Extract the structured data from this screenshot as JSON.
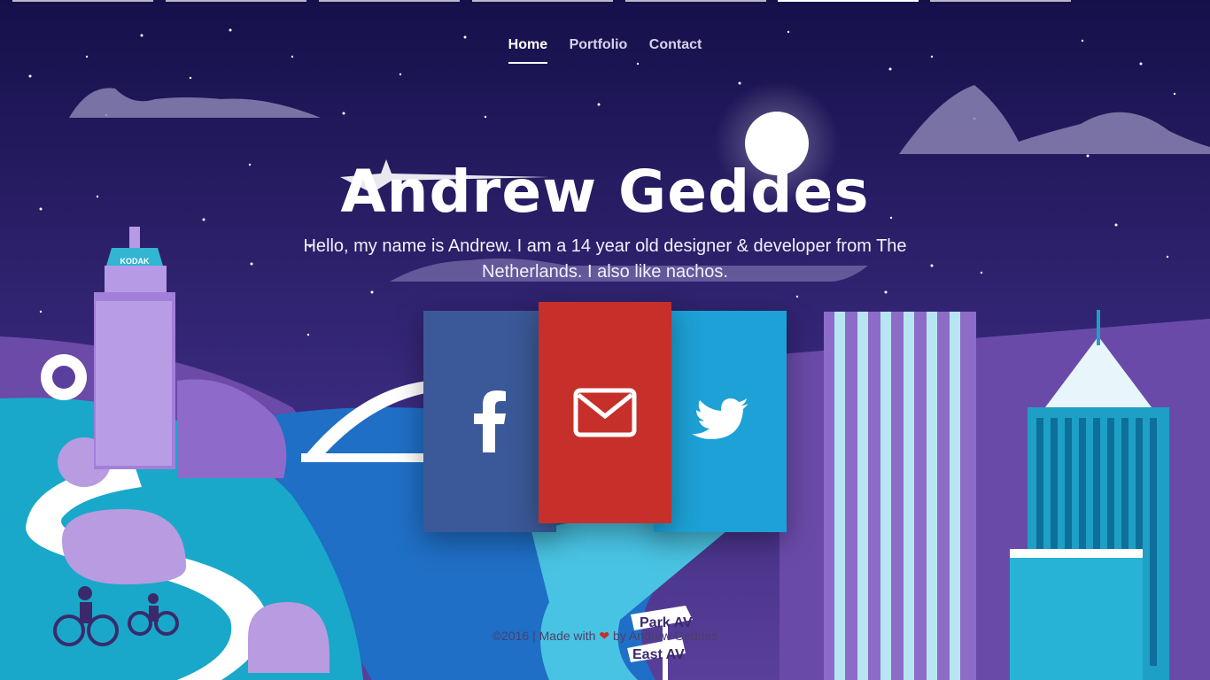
{
  "nav": {
    "items": [
      {
        "label": "Home",
        "active": true
      },
      {
        "label": "Portfolio",
        "active": false
      },
      {
        "label": "Contact",
        "active": false
      }
    ]
  },
  "hero": {
    "title": "Andrew Geddes",
    "subtitle": "Hello, my name is Andrew. I am a 14 year old designer & developer from The Netherlands. I also like nachos."
  },
  "social": {
    "facebook_icon": "facebook-icon",
    "mail_icon": "mail-icon",
    "twitter_icon": "twitter-icon"
  },
  "footer": {
    "prefix": "©2016 | Made with",
    "suffix": "by Andrew Geddes"
  },
  "illustration": {
    "kodak_sign": "KODAK",
    "sign_top": "Park AV",
    "sign_bottom": "East AV"
  },
  "colors": {
    "facebook": "#3b5998",
    "mail": "#c62f2a",
    "twitter": "#1da1d6",
    "sky": "#1a1250"
  }
}
